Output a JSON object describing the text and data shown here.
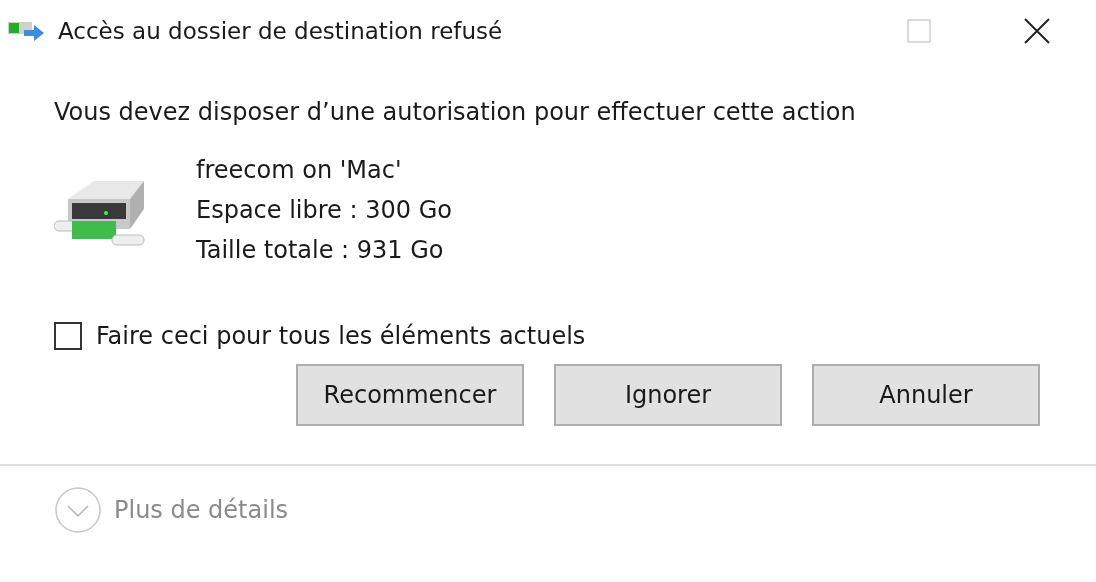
{
  "window": {
    "title": "Accès au dossier de destination refusé",
    "maximize_disabled": true
  },
  "message": "Vous devez disposer d’une autorisation pour effectuer cette action",
  "drive": {
    "lines": [
      "freecom on 'Mac'",
      "Espace libre : 300 Go",
      "Taille totale : 931 Go"
    ]
  },
  "apply_all": {
    "label": "Faire ceci pour tous les éléments actuels",
    "checked": false
  },
  "buttons": [
    "Recommencer",
    "Ignorer",
    "Annuler"
  ],
  "details": {
    "label": "Plus de détails",
    "expanded": false
  }
}
